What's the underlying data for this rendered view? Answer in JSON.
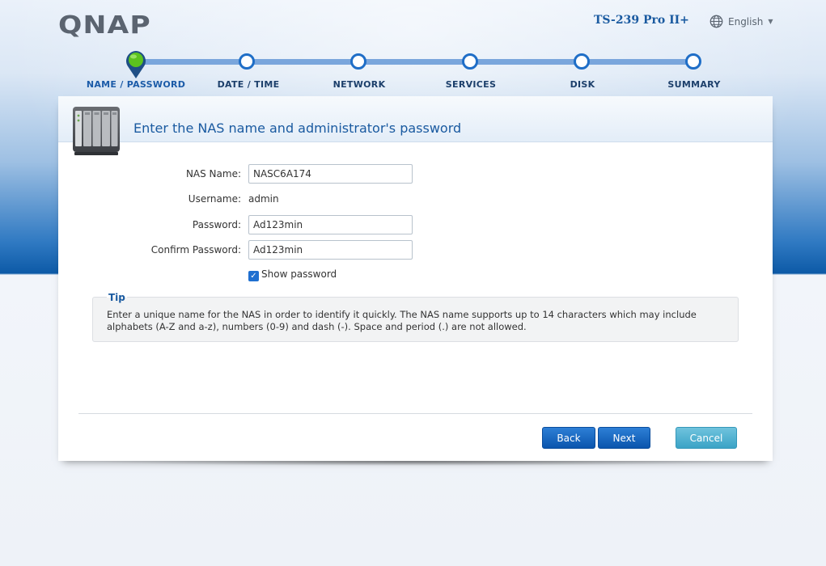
{
  "header": {
    "brand": "QNAP",
    "model": "TS-239 Pro II+",
    "language": "English"
  },
  "steps": [
    {
      "label": "NAME / PASSWORD",
      "state": "active"
    },
    {
      "label": "DATE / TIME",
      "state": "pending"
    },
    {
      "label": "NETWORK",
      "state": "pending"
    },
    {
      "label": "SERVICES",
      "state": "pending"
    },
    {
      "label": "DISK",
      "state": "pending"
    },
    {
      "label": "SUMMARY",
      "state": "pending"
    }
  ],
  "panel": {
    "title": "Enter the NAS name and administrator's password"
  },
  "form": {
    "nas_name_label": "NAS Name:",
    "nas_name_value": "NASC6A174",
    "username_label": "Username:",
    "username_value": "admin",
    "password_label": "Password:",
    "password_value": "Ad123min",
    "confirm_label": "Confirm Password:",
    "confirm_value": "Ad123min",
    "show_password_label": "Show password",
    "show_password_checked": true
  },
  "tip": {
    "title": "Tip",
    "line1": "Enter a unique name for the NAS in order to identify it quickly. The NAS name supports up to 14 characters which may include",
    "line2": "alphabets (A-Z and a-z), numbers (0-9) and dash (-). Space and period (.) are not allowed."
  },
  "buttons": {
    "back": "Back",
    "next": "Next",
    "cancel": "Cancel"
  },
  "colors": {
    "accent": "#1a5aa0",
    "button_blue": "#0b55ad",
    "button_teal": "#3ba3c6",
    "active_step": "#5cc31f"
  }
}
